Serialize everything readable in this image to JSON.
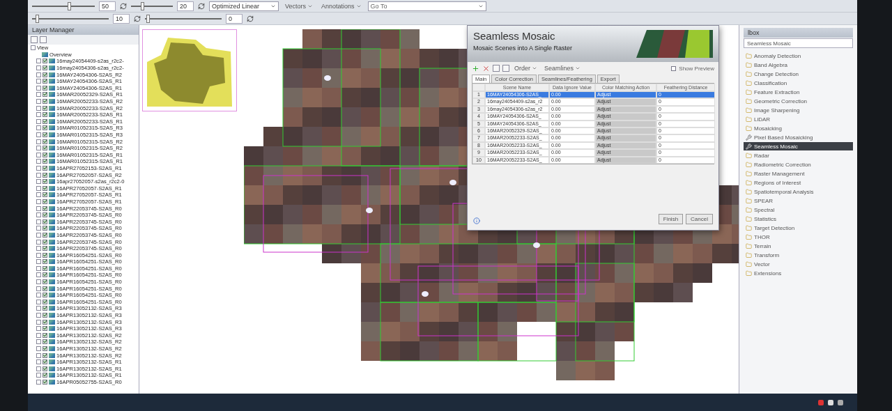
{
  "toolbar": {
    "brightness": {
      "level": 0.6,
      "reading": "50"
    },
    "contrast": {
      "level": 0.25,
      "reading": "20"
    },
    "stretch": "Optimized Linear",
    "sharpen": {
      "level": 0.05,
      "reading": "10"
    },
    "transparency": {
      "level": 0.02,
      "reading": "0"
    },
    "vectors": "Vectors",
    "annotations": "Annotations",
    "goto": {
      "placeholder": "Go To"
    }
  },
  "layer_manager": {
    "title": "Layer Manager",
    "tree": {
      "label": "View",
      "children": [
        {
          "label": "Overview",
          "kind": "overview"
        },
        {
          "label": "16may24054409-s2as_r2c2-",
          "checked": true,
          "kind": "raster"
        },
        {
          "label": "16may24054306-s2as_r2c2-",
          "checked": true,
          "kind": "raster"
        },
        {
          "label": "16MAY24054306-S2AS_R2",
          "checked": true,
          "kind": "raster"
        },
        {
          "label": "16MAY24054306-S2AS_R1",
          "checked": true,
          "kind": "raster"
        },
        {
          "label": "16MAY24054306-S2AS_R1",
          "checked": true,
          "kind": "raster"
        },
        {
          "label": "16MAR20052329-S2AS_R1",
          "checked": true,
          "kind": "raster"
        },
        {
          "label": "16MAR20052233-S2AS_R2",
          "checked": true,
          "kind": "raster"
        },
        {
          "label": "16MAR20052233-S2AS_R2",
          "checked": true,
          "kind": "raster"
        },
        {
          "label": "16MAR20052233-S2AS_R1",
          "checked": true,
          "kind": "raster"
        },
        {
          "label": "16MAR20052233-S2AS_R1",
          "checked": true,
          "kind": "raster"
        },
        {
          "label": "16MAR01052315-S2AS_R3",
          "checked": true,
          "kind": "raster"
        },
        {
          "label": "16MAR01052315-S2AS_R3",
          "checked": true,
          "kind": "raster"
        },
        {
          "label": "16MAR01052315-S2AS_R2",
          "checked": true,
          "kind": "raster"
        },
        {
          "label": "16MAR01052315-S2AS_R2",
          "checked": true,
          "kind": "raster"
        },
        {
          "label": "16MAR01052315-S2AS_R1",
          "checked": true,
          "kind": "raster"
        },
        {
          "label": "16MAR01052315-S2AS_R1",
          "checked": true,
          "kind": "raster"
        },
        {
          "label": "16APR27052153-S2AS_R1",
          "checked": true,
          "kind": "raster"
        },
        {
          "label": "16APR27052057-S2AS_R2",
          "checked": true,
          "kind": "raster"
        },
        {
          "label": "16apr27052057-s2as_r2c2-0",
          "checked": true,
          "kind": "raster"
        },
        {
          "label": "16APR27052057-S2AS_R1",
          "checked": true,
          "kind": "raster"
        },
        {
          "label": "16APR27052057-S2AS_R1",
          "checked": true,
          "kind": "raster"
        },
        {
          "label": "16APR27052057-S2AS_R1",
          "checked": true,
          "kind": "raster"
        },
        {
          "label": "16APR22053745-S2AS_R0",
          "checked": true,
          "kind": "raster"
        },
        {
          "label": "16APR22053745-S2AS_R0",
          "checked": true,
          "kind": "raster"
        },
        {
          "label": "16APR22053745-S2AS_R0",
          "checked": true,
          "kind": "raster"
        },
        {
          "label": "16APR22053745-S2AS_R0",
          "checked": true,
          "kind": "raster"
        },
        {
          "label": "16APR22053745-S2AS_R0",
          "checked": true,
          "kind": "raster"
        },
        {
          "label": "16APR22053745-S2AS_R0",
          "checked": true,
          "kind": "raster"
        },
        {
          "label": "16APR22053745-S2AS_R0",
          "checked": true,
          "kind": "raster"
        },
        {
          "label": "16APR16054251-S2AS_R0",
          "checked": true,
          "kind": "raster"
        },
        {
          "label": "16APR16054251-S2AS_R0",
          "checked": true,
          "kind": "raster"
        },
        {
          "label": "16APR16054251-S2AS_R0",
          "checked": true,
          "kind": "raster"
        },
        {
          "label": "16APR16054251-S2AS_R0",
          "checked": true,
          "kind": "raster"
        },
        {
          "label": "16APR16054251-S2AS_R0",
          "checked": true,
          "kind": "raster"
        },
        {
          "label": "16APR16054251-S2AS_R0",
          "checked": true,
          "kind": "raster"
        },
        {
          "label": "16APR16054251-S2AS_R0",
          "checked": true,
          "kind": "raster"
        },
        {
          "label": "16APR16054251-S2AS_R0",
          "checked": true,
          "kind": "raster"
        },
        {
          "label": "16APR13052132-S2AS_R3",
          "checked": true,
          "kind": "raster"
        },
        {
          "label": "16APR13052132-S2AS_R3",
          "checked": true,
          "kind": "raster"
        },
        {
          "label": "16APR13052132-S2AS_R3",
          "checked": true,
          "kind": "raster"
        },
        {
          "label": "16APR13052132-S2AS_R3",
          "checked": true,
          "kind": "raster"
        },
        {
          "label": "16APR13052132-S2AS_R2",
          "checked": true,
          "kind": "raster"
        },
        {
          "label": "16APR13052132-S2AS_R2",
          "checked": true,
          "kind": "raster"
        },
        {
          "label": "16APR13052132-S2AS_R2",
          "checked": true,
          "kind": "raster"
        },
        {
          "label": "16APR13052132-S2AS_R2",
          "checked": true,
          "kind": "raster"
        },
        {
          "label": "16APR13052132-S2AS_R1",
          "checked": true,
          "kind": "raster"
        },
        {
          "label": "16APR13052132-S2AS_R1",
          "checked": true,
          "kind": "raster"
        },
        {
          "label": "16APR13052132-S2AS_R1",
          "checked": true,
          "kind": "raster"
        },
        {
          "label": "16APR05052755-S2AS_R0",
          "checked": true,
          "kind": "raster"
        }
      ]
    }
  },
  "dialog": {
    "title": "Seamless Mosaic",
    "subtitle": "Mosaic Scenes into A Single Raster",
    "order": "Order",
    "seamlines": "Seamlines",
    "show_preview": {
      "label": "Show Preview",
      "checked": false
    },
    "tabs": [
      {
        "label": "Main",
        "selected": true
      },
      {
        "label": "Color Correction",
        "selected": false
      },
      {
        "label": "Seamlines/Feathering",
        "selected": false
      },
      {
        "label": "Export",
        "selected": false
      }
    ],
    "columns": [
      "Scene Name",
      "Data Ignore Value",
      "Color Matching Action",
      "Feathering Distance"
    ],
    "rows": [
      {
        "index": "1",
        "scene": "16MAY24054306-S2AS_",
        "ignore": "0.00",
        "action": "Adjust",
        "feather": "0",
        "selected": true
      },
      {
        "index": "2",
        "scene": "16may24054409-s2as_r2",
        "ignore": "0.00",
        "action": "Adjust",
        "feather": "0",
        "selected": false
      },
      {
        "index": "3",
        "scene": "16may24054306-s2as_r2",
        "ignore": "0.00",
        "action": "Adjust",
        "feather": "0",
        "selected": false
      },
      {
        "index": "4",
        "scene": "16MAY24054306-S2AS_",
        "ignore": "0.00",
        "action": "Adjust",
        "feather": "0",
        "selected": false
      },
      {
        "index": "5",
        "scene": "16MAY24054306-S2AS_",
        "ignore": "0.00",
        "action": "Adjust",
        "feather": "0",
        "selected": false
      },
      {
        "index": "6",
        "scene": "16MAR20052329-S2AS_",
        "ignore": "0.00",
        "action": "Adjust",
        "feather": "0",
        "selected": false
      },
      {
        "index": "7",
        "scene": "16MAR20052233-S2AS_",
        "ignore": "0.00",
        "action": "Adjust",
        "feather": "0",
        "selected": false
      },
      {
        "index": "8",
        "scene": "16MAR20052233-S2AS_",
        "ignore": "0.00",
        "action": "Adjust",
        "feather": "0",
        "selected": false
      },
      {
        "index": "9",
        "scene": "16MAR20052233-S2AS_",
        "ignore": "0.00",
        "action": "Adjust",
        "feather": "0",
        "selected": false
      },
      {
        "index": "10",
        "scene": "16MAR20052233-S2AS_",
        "ignore": "0.00",
        "action": "Adjust",
        "feather": "0",
        "selected": false
      }
    ],
    "buttons": [
      "Finish",
      "Cancel"
    ]
  },
  "toolbox": {
    "title": "lbox",
    "search": "Seamless Mosaic",
    "items": [
      {
        "label": "Anomaly Detection",
        "kind": "folder",
        "selected": false
      },
      {
        "label": "Band Algebra",
        "kind": "folder",
        "selected": false
      },
      {
        "label": "Change Detection",
        "kind": "folder",
        "selected": false
      },
      {
        "label": "Classification",
        "kind": "folder",
        "selected": false
      },
      {
        "label": "Feature Extraction",
        "kind": "folder",
        "selected": false
      },
      {
        "label": "Geometric Correction",
        "kind": "folder",
        "selected": false
      },
      {
        "label": "Image Sharpening",
        "kind": "folder",
        "selected": false
      },
      {
        "label": "LiDAR",
        "kind": "folder",
        "selected": false
      },
      {
        "label": "Mosaicking",
        "kind": "folder",
        "selected": false
      },
      {
        "label": "Pixel Based Mosaicking",
        "kind": "tool",
        "selected": false
      },
      {
        "label": "Seamless Mosaic",
        "kind": "tool",
        "selected": true
      },
      {
        "label": "Radar",
        "kind": "folder",
        "selected": false
      },
      {
        "label": "Radiometric Correction",
        "kind": "folder",
        "selected": false
      },
      {
        "label": "Raster Management",
        "kind": "folder",
        "selected": false
      },
      {
        "label": "Regions of Interest",
        "kind": "folder",
        "selected": false
      },
      {
        "label": "Spatiotemporal Analysis",
        "kind": "folder",
        "selected": false
      },
      {
        "label": "SPEAR",
        "kind": "folder",
        "selected": false
      },
      {
        "label": "Spectral",
        "kind": "folder",
        "selected": false
      },
      {
        "label": "Statistics",
        "kind": "folder",
        "selected": false
      },
      {
        "label": "Target Detection",
        "kind": "folder",
        "selected": false
      },
      {
        "label": "THOR",
        "kind": "folder",
        "selected": false
      },
      {
        "label": "Terrain",
        "kind": "folder",
        "selected": false
      },
      {
        "label": "Transform",
        "kind": "folder",
        "selected": false
      },
      {
        "label": "Vector",
        "kind": "folder",
        "selected": false
      },
      {
        "label": "Extensions",
        "kind": "folder",
        "selected": false
      }
    ]
  }
}
